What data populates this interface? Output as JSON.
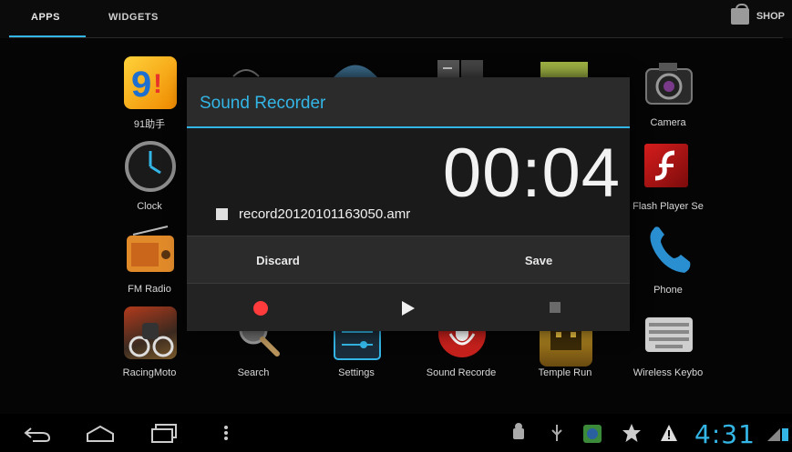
{
  "tabs": {
    "apps": "APPS",
    "widgets": "WIDGETS",
    "shop": "SHOP"
  },
  "apps": {
    "a91": "91助手",
    "clock": "Clock",
    "fm": "FM Radio",
    "racing": "RacingMoto",
    "camera": "Camera",
    "flash": "Flash Player Se",
    "phone": "Phone",
    "search": "Search",
    "settings": "Settings",
    "sound": "Sound Recorde",
    "temple": "Temple Run",
    "keyboard": "Wireless Keybo"
  },
  "dialog": {
    "title": "Sound Recorder",
    "timer": "00:04",
    "filename": "record20120101163050.amr",
    "discard": "Discard",
    "save": "Save"
  },
  "statusbar": {
    "time": "4:31"
  },
  "colors": {
    "accent": "#33b5e5",
    "record": "#ff3b3b"
  }
}
